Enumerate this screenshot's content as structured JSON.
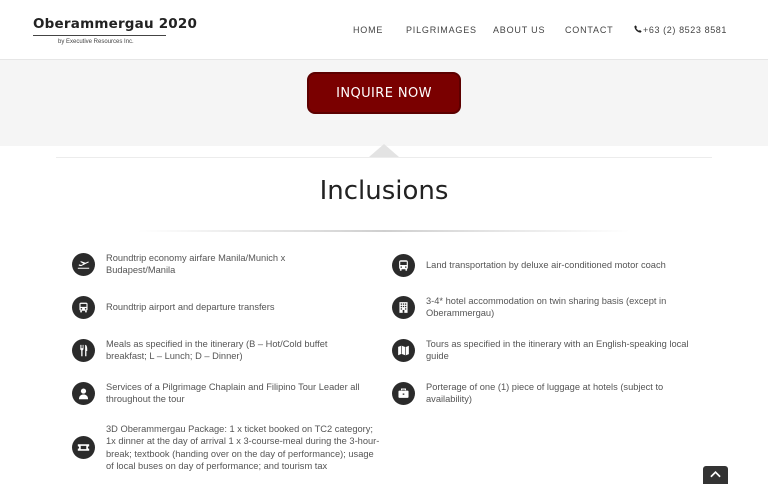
{
  "header": {
    "logo_title": "Oberammergau 2020",
    "logo_subtitle": "by Executive Resources Inc.",
    "nav": {
      "home": "HOME",
      "pilgrimages": "PILGRIMAGES",
      "about": "ABOUT US",
      "contact": "CONTACT",
      "phone": "+63 (2) 8523 8581"
    }
  },
  "banner": {
    "cta_label": "INQUIRE NOW"
  },
  "section": {
    "title": "Inclusions"
  },
  "inclusions_left": [
    {
      "icon": "plane-icon",
      "text": "Roundtrip economy airfare Manila/Munich x Budapest/Manila"
    },
    {
      "icon": "car-icon",
      "text": "Roundtrip airport and departure transfers"
    },
    {
      "icon": "meal-icon",
      "text": "Meals as specified in the itinerary (B – Hot/Cold buffet breakfast; L – Lunch; D – Dinner)"
    },
    {
      "icon": "user-icon",
      "text": "Services of a Pilgrimage Chaplain and Filipino Tour Leader all throughout the tour"
    },
    {
      "icon": "ticket-icon",
      "text": "3D Oberammergau Package: 1 x ticket booked on TC2 category; 1x dinner at the day of arrival 1 x 3-course-meal during the 3-hour-break; textbook (handing over on the day of performance); usage of local buses on day of performance; and tourism tax"
    }
  ],
  "inclusions_right": [
    {
      "icon": "bus-icon",
      "text": "Land transportation by deluxe air-conditioned motor coach"
    },
    {
      "icon": "hotel-icon",
      "text": "3-4* hotel accommodation on twin sharing basis (except in Oberammergau)"
    },
    {
      "icon": "map-icon",
      "text": "Tours as specified in the itinerary with an English-speaking local guide"
    },
    {
      "icon": "briefcase-icon",
      "text": "Porterage of one (1) piece of luggage at hotels (subject to availability)"
    }
  ],
  "colors": {
    "accent": "#7a0000",
    "icon_bg": "#2b2b2b",
    "banner_bg": "#f5f5f5"
  }
}
